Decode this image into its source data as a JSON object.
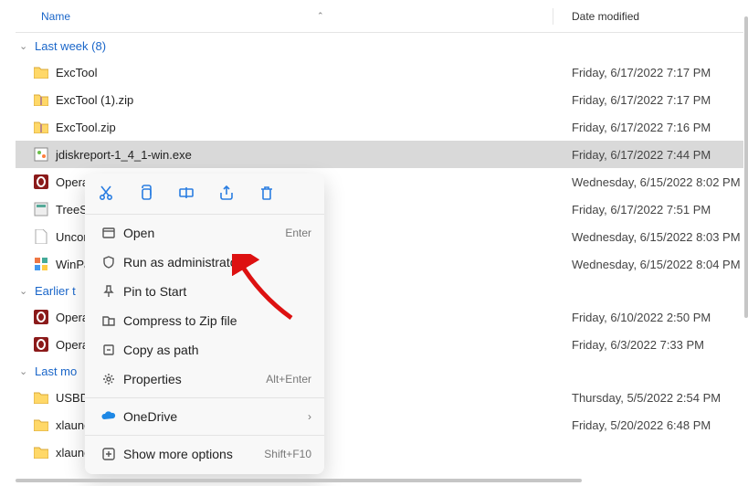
{
  "header": {
    "name_label": "Name",
    "date_label": "Date modified"
  },
  "groups": {
    "last_week": {
      "label": "Last week (8)"
    },
    "earlier_month": {
      "label": "Earlier t"
    },
    "last_month": {
      "label": "Last mo"
    }
  },
  "rows": {
    "exctool_folder": {
      "name": "ExcTool",
      "date": "Friday, 6/17/2022 7:17 PM"
    },
    "exctool1_zip": {
      "name": "ExcTool (1).zip",
      "date": "Friday, 6/17/2022 7:17 PM"
    },
    "exctool_zip": {
      "name": "ExcTool.zip",
      "date": "Friday, 6/17/2022 7:16 PM"
    },
    "jdisk": {
      "name": "jdiskreport-1_4_1-win.exe",
      "date": "Friday, 6/17/2022 7:44 PM"
    },
    "opera1": {
      "name": "Opera",
      "date": "Wednesday, 6/15/2022 8:02 PM"
    },
    "treesize": {
      "name": "TreeSiz",
      "date": "Friday, 6/17/2022 7:51 PM"
    },
    "uncor": {
      "name": "Uncor",
      "date": "Wednesday, 6/15/2022 8:03 PM"
    },
    "winpa": {
      "name": "WinPa",
      "date": "Wednesday, 6/15/2022 8:04 PM"
    },
    "opera2": {
      "name": "Opera",
      "date": "Friday, 6/10/2022 2:50 PM"
    },
    "opera3": {
      "name": "Opera",
      "date": "Friday, 6/3/2022 7:33 PM"
    },
    "usbdi": {
      "name": "USBDi",
      "date": "Thursday, 5/5/2022 2:54 PM"
    },
    "xlaunch": {
      "name": "xlaunc",
      "date": "Friday, 5/20/2022 6:48 PM"
    },
    "xlaunch2": {
      "name": "xlaunch",
      "date": ""
    }
  },
  "menu": {
    "open": {
      "label": "Open",
      "shortcut": "Enter"
    },
    "run_admin": {
      "label": "Run as administrator"
    },
    "pin_start": {
      "label": "Pin to Start"
    },
    "compress": {
      "label": "Compress to Zip file"
    },
    "copy_path": {
      "label": "Copy as path"
    },
    "properties": {
      "label": "Properties",
      "shortcut": "Alt+Enter"
    },
    "onedrive": {
      "label": "OneDrive"
    },
    "more": {
      "label": "Show more options",
      "shortcut": "Shift+F10"
    }
  }
}
